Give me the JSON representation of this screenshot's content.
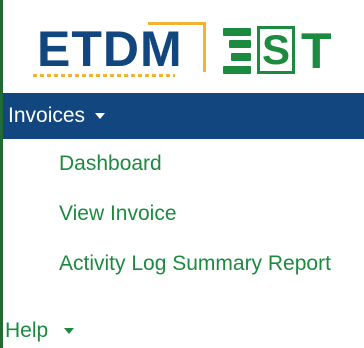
{
  "branding": {
    "logo_primary": "ETDM",
    "logo_secondary": "EST",
    "colors": {
      "primary_blue": "#12467f",
      "accent_gold": "#f2b233",
      "accent_green": "#1c8a3f"
    }
  },
  "menu": {
    "invoices": {
      "label": "Invoices",
      "items": [
        {
          "label": "Dashboard"
        },
        {
          "label": "View Invoice"
        },
        {
          "label": "Activity Log Summary Report"
        }
      ]
    },
    "help": {
      "label": "Help"
    }
  }
}
